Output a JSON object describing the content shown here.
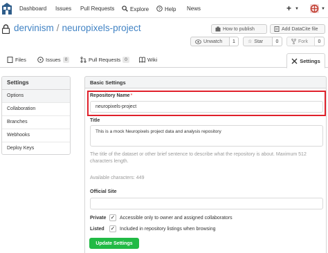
{
  "nav": {
    "dashboard": "Dashboard",
    "issues": "Issues",
    "pull_requests": "Pull Requests",
    "explore": "Explore",
    "help": "Help",
    "news": "News",
    "plus": "+"
  },
  "repo": {
    "owner": "dervinism",
    "separator": "/",
    "name": "neuropixels-project",
    "how_to_publish": "How to publish",
    "add_datacite": "Add DataCite file",
    "unwatch_label": "Unwatch",
    "unwatch_count": "1",
    "star_label": "Star",
    "star_count": "0",
    "fork_label": "Fork",
    "fork_count": "0"
  },
  "tabs": {
    "files": "Files",
    "issues": "Issues",
    "issues_count": "0",
    "pull_requests": "Pull Requests",
    "pull_requests_count": "0",
    "wiki": "Wiki",
    "settings": "Settings"
  },
  "sidebar": {
    "header": "Settings",
    "items": [
      {
        "label": "Options"
      },
      {
        "label": "Collaboration"
      },
      {
        "label": "Branches"
      },
      {
        "label": "Webhooks"
      },
      {
        "label": "Deploy Keys"
      }
    ]
  },
  "form": {
    "section_title": "Basic Settings",
    "repo_name_label": "Repository Name",
    "required_mark": "*",
    "repo_name_value": "neuropixels-project",
    "title_label": "Title",
    "title_value": "This is a mock Neuropixels project data and analysis repository",
    "title_help": "The title of the dataset or other brief sentence to describe what the repository is about. Maximum 512 characters length.",
    "available_chars": "Available characters: 449",
    "official_site_label": "Official Site",
    "official_site_value": "",
    "private_label": "Private",
    "private_text": "Accessible only to owner and assigned collaborators",
    "private_checked": true,
    "listed_label": "Listed",
    "listed_text": "Included in repository listings when browsing",
    "listed_checked": true,
    "update_button": "Update Settings"
  },
  "colors": {
    "accent_blue": "#4183c4",
    "highlight_red": "#e0202a",
    "button_green": "#21ba45"
  }
}
